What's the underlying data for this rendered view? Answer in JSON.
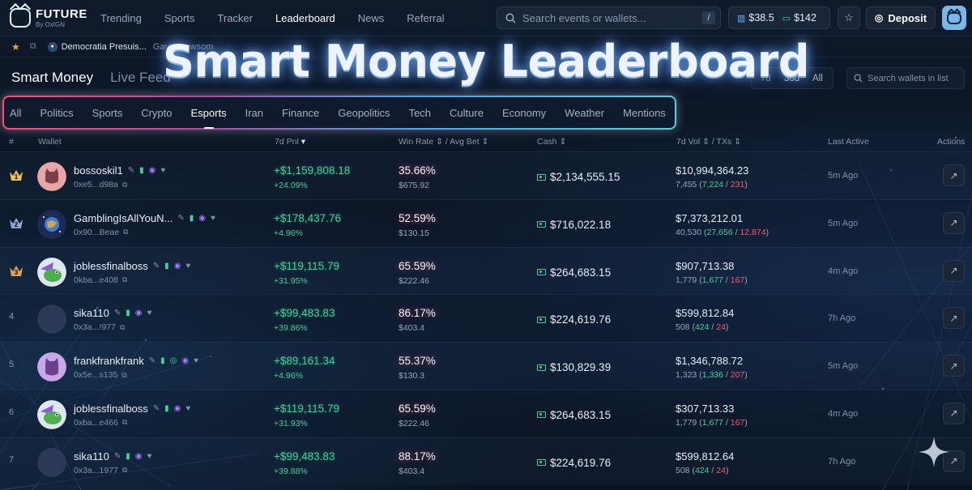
{
  "brand": {
    "name": "FUTURE",
    "sub": "By OxIGN"
  },
  "nav": [
    {
      "label": "Trending",
      "active": false
    },
    {
      "label": "Sports",
      "active": false
    },
    {
      "label": "Tracker",
      "active": false
    },
    {
      "label": "Leaderboard",
      "active": true
    },
    {
      "label": "News",
      "active": false
    },
    {
      "label": "Referral",
      "active": false
    }
  ],
  "search": {
    "placeholder": "Search events or wallets...",
    "shortcut": "/"
  },
  "balances": {
    "portfolio": "$38.5",
    "cash": "$142"
  },
  "deposit_label": "Deposit",
  "ticker": {
    "item1": "Democratia Presuis...",
    "item2": "Gavin Newsom"
  },
  "hero_title": "Smart Money Leaderboard",
  "view_tabs": [
    {
      "label": "Smart Money",
      "active": true
    },
    {
      "label": "Live Feed",
      "active": false
    }
  ],
  "time_ranges": [
    {
      "label": "7d",
      "active": true
    },
    {
      "label": "30d",
      "active": false
    },
    {
      "label": "All",
      "active": false
    }
  ],
  "list_search_placeholder": "Search wallets in list",
  "categories": [
    {
      "label": "All",
      "active": false
    },
    {
      "label": "Politics",
      "active": false
    },
    {
      "label": "Sports",
      "active": false
    },
    {
      "label": "Crypto",
      "active": false
    },
    {
      "label": "Esports",
      "active": true
    },
    {
      "label": "Iran",
      "active": false
    },
    {
      "label": "Finance",
      "active": false
    },
    {
      "label": "Geopolitics",
      "active": false
    },
    {
      "label": "Tech",
      "active": false
    },
    {
      "label": "Culture",
      "active": false
    },
    {
      "label": "Economy",
      "active": false
    },
    {
      "label": "Weather",
      "active": false
    },
    {
      "label": "Mentions",
      "active": false
    }
  ],
  "columns": {
    "rank": "#",
    "wallet": "Wallet",
    "pnl": "7d Pnl",
    "winrate": "Win Rate",
    "avgbet": "Avg Bet",
    "cash": "Cash",
    "vol": "7d Vol",
    "txs": "TXs",
    "last": "Last Active",
    "actions": "Actions"
  },
  "rows": [
    {
      "rank": "1",
      "crown": "gold",
      "avatar": "pink-cat",
      "name": "bossoskil1",
      "addr": "0xe5...d98a",
      "pnl": "+$1,159,808.18",
      "pnl_pct": "+24.09%",
      "win_rate": "35.66%",
      "avg_bet": "$675.92",
      "cash": "$2,134,555.15",
      "vol": "$10,994,364.23",
      "txs_total": "7,455",
      "txs_buy": "7,224",
      "txs_sell": "231",
      "last": "5m Ago"
    },
    {
      "rank": "2",
      "crown": "silver",
      "avatar": "space-globe",
      "name": "GamblingIsAllYouN...",
      "addr": "0x90...Beae",
      "pnl": "+$178,437.76",
      "pnl_pct": "+4.96%",
      "win_rate": "52.59%",
      "avg_bet": "$130.15",
      "cash": "$716,022.18",
      "vol": "$7,373,212.01",
      "txs_total": "40,530",
      "txs_buy": "27,656",
      "txs_sell": "12,874",
      "last": "5m Ago"
    },
    {
      "rank": "3",
      "crown": "bronze",
      "avatar": "green-frog",
      "name": "joblessfinalboss",
      "addr": "0kba...e408",
      "pnl": "+$119,115.79",
      "pnl_pct": "+31.95%",
      "win_rate": "65.59%",
      "avg_bet": "$222.46",
      "cash": "$264,683.15",
      "vol": "$907,713.38",
      "txs_total": "1,779",
      "txs_buy": "1,677",
      "txs_sell": "167",
      "last": "4m Ago"
    },
    {
      "rank": "4",
      "crown": "",
      "avatar": "blank",
      "name": "sika110",
      "addr": "0x3a...!977",
      "pnl": "+$99,483.83",
      "pnl_pct": "+39.86%",
      "win_rate": "86.17%",
      "avg_bet": "$403.4",
      "cash": "$224,619.76",
      "vol": "$599,812.84",
      "txs_total": "508",
      "txs_buy": "424",
      "txs_sell": "24",
      "last": "7h Ago"
    },
    {
      "rank": "5",
      "crown": "",
      "avatar": "purple-cat",
      "name": "frankfrankfrank",
      "addr": "0x5e...s135",
      "pnl": "+$89,161.34",
      "pnl_pct": "+4.96%",
      "win_rate": "55.37%",
      "avg_bet": "$130.3",
      "cash": "$130,829.39",
      "vol": "$1,346,788.72",
      "txs_total": "1,323",
      "txs_buy": "1,336",
      "txs_sell": "207",
      "last": "5m Ago"
    },
    {
      "rank": "6",
      "crown": "",
      "avatar": "green-frog",
      "name": "joblessfinalboss",
      "addr": "0xba...e466",
      "pnl": "+$119,115.79",
      "pnl_pct": "+31.93%",
      "win_rate": "65.59%",
      "avg_bet": "$222.46",
      "cash": "$264,683.15",
      "vol": "$307,713.33",
      "txs_total": "1,779",
      "txs_buy": "1,677",
      "txs_sell": "167",
      "last": "4m Ago"
    },
    {
      "rank": "7",
      "crown": "",
      "avatar": "blank",
      "name": "sika110",
      "addr": "0x3a...1977",
      "pnl": "+$99,483.83",
      "pnl_pct": "+39.88%",
      "win_rate": "88.17%",
      "avg_bet": "$403.4",
      "cash": "$224,619.76",
      "vol": "$599,812.64",
      "txs_total": "508",
      "txs_buy": "424",
      "txs_sell": "24",
      "last": "7h Ago"
    }
  ],
  "colors": {
    "positive": "#43d39a",
    "negative": "#ff5a6e",
    "gold": "#f2c14e",
    "silver": "#8fa6d6",
    "bronze": "#e0a25a"
  }
}
